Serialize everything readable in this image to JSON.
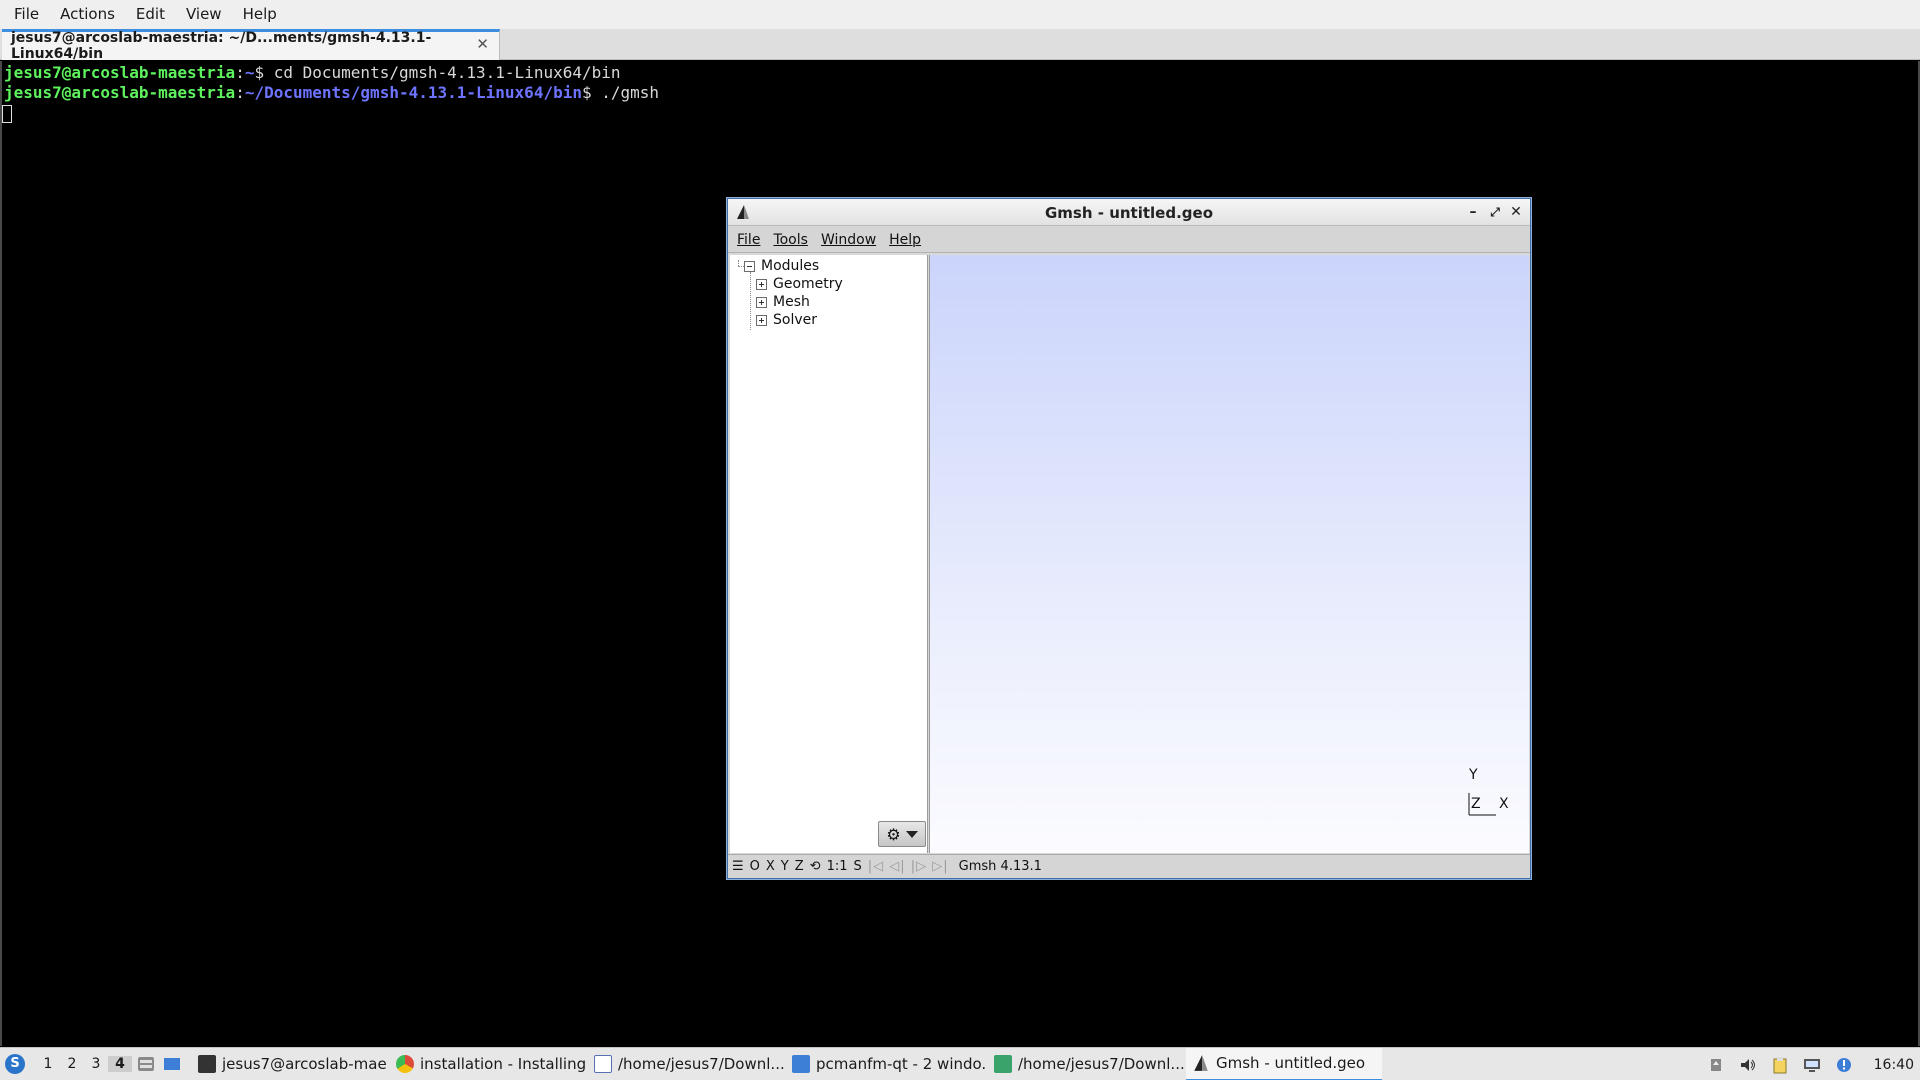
{
  "terminal": {
    "menu": [
      "File",
      "Actions",
      "Edit",
      "View",
      "Help"
    ],
    "tab_title": "jesus7@arcoslab-maestria: ~/D...ments/gmsh-4.13.1-Linux64/bin",
    "tab_close": "✕",
    "lines": [
      {
        "user": "jesus7@arcoslab-maestria",
        "sep": ":",
        "path": "~",
        "cmd": "$ cd Documents/gmsh-4.13.1-Linux64/bin"
      },
      {
        "user": "jesus7@arcoslab-maestria",
        "sep": ":",
        "path": "~/Documents/gmsh-4.13.1-Linux64/bin",
        "cmd": "$ ./gmsh"
      }
    ]
  },
  "gmsh": {
    "title": "Gmsh - untitled.geo",
    "controls": {
      "minimize": "–",
      "maximize": "⤢",
      "close": "✕"
    },
    "menu": [
      "File",
      "Tools",
      "Window",
      "Help"
    ],
    "tree": {
      "root": "Modules",
      "children": [
        "Geometry",
        "Mesh",
        "Solver"
      ]
    },
    "axes": {
      "y": "Y",
      "z": "Z",
      "x": "X"
    },
    "status": {
      "menu_glyph": "☰",
      "o": "O",
      "x": "X",
      "y": "Y",
      "z": "Z",
      "rotate_glyph": "⟲",
      "scale": "1:1",
      "s": "S",
      "nav": "|◁ ◁| |▷ ▷|",
      "version": "Gmsh 4.13.1"
    }
  },
  "taskbar": {
    "desktops": [
      "1",
      "2",
      "3",
      "4"
    ],
    "active_desktop": "4",
    "tasks": [
      {
        "label": "jesus7@arcoslab-mae...",
        "icon": "terminal-icon",
        "color": "#333333"
      },
      {
        "label": "installation - Installing...",
        "icon": "chrome-icon",
        "color": "#dd4b39"
      },
      {
        "label": "/home/jesus7/Downl...",
        "icon": "text-editor-icon",
        "color": "#5a6fb0"
      },
      {
        "label": "pcmanfm-qt - 2 windo...",
        "icon": "folder-icon",
        "color": "#3d7fd6"
      },
      {
        "label": "/home/jesus7/Downl...",
        "icon": "image-viewer-icon",
        "color": "#3aa36b"
      },
      {
        "label": "Gmsh - untitled.geo",
        "icon": "gmsh-icon",
        "color": "#222222"
      }
    ],
    "clock": "16:40"
  },
  "colors": {
    "prompt_user": "#5ef35e",
    "prompt_path": "#6e74ff",
    "accent": "#3d8ee0"
  }
}
